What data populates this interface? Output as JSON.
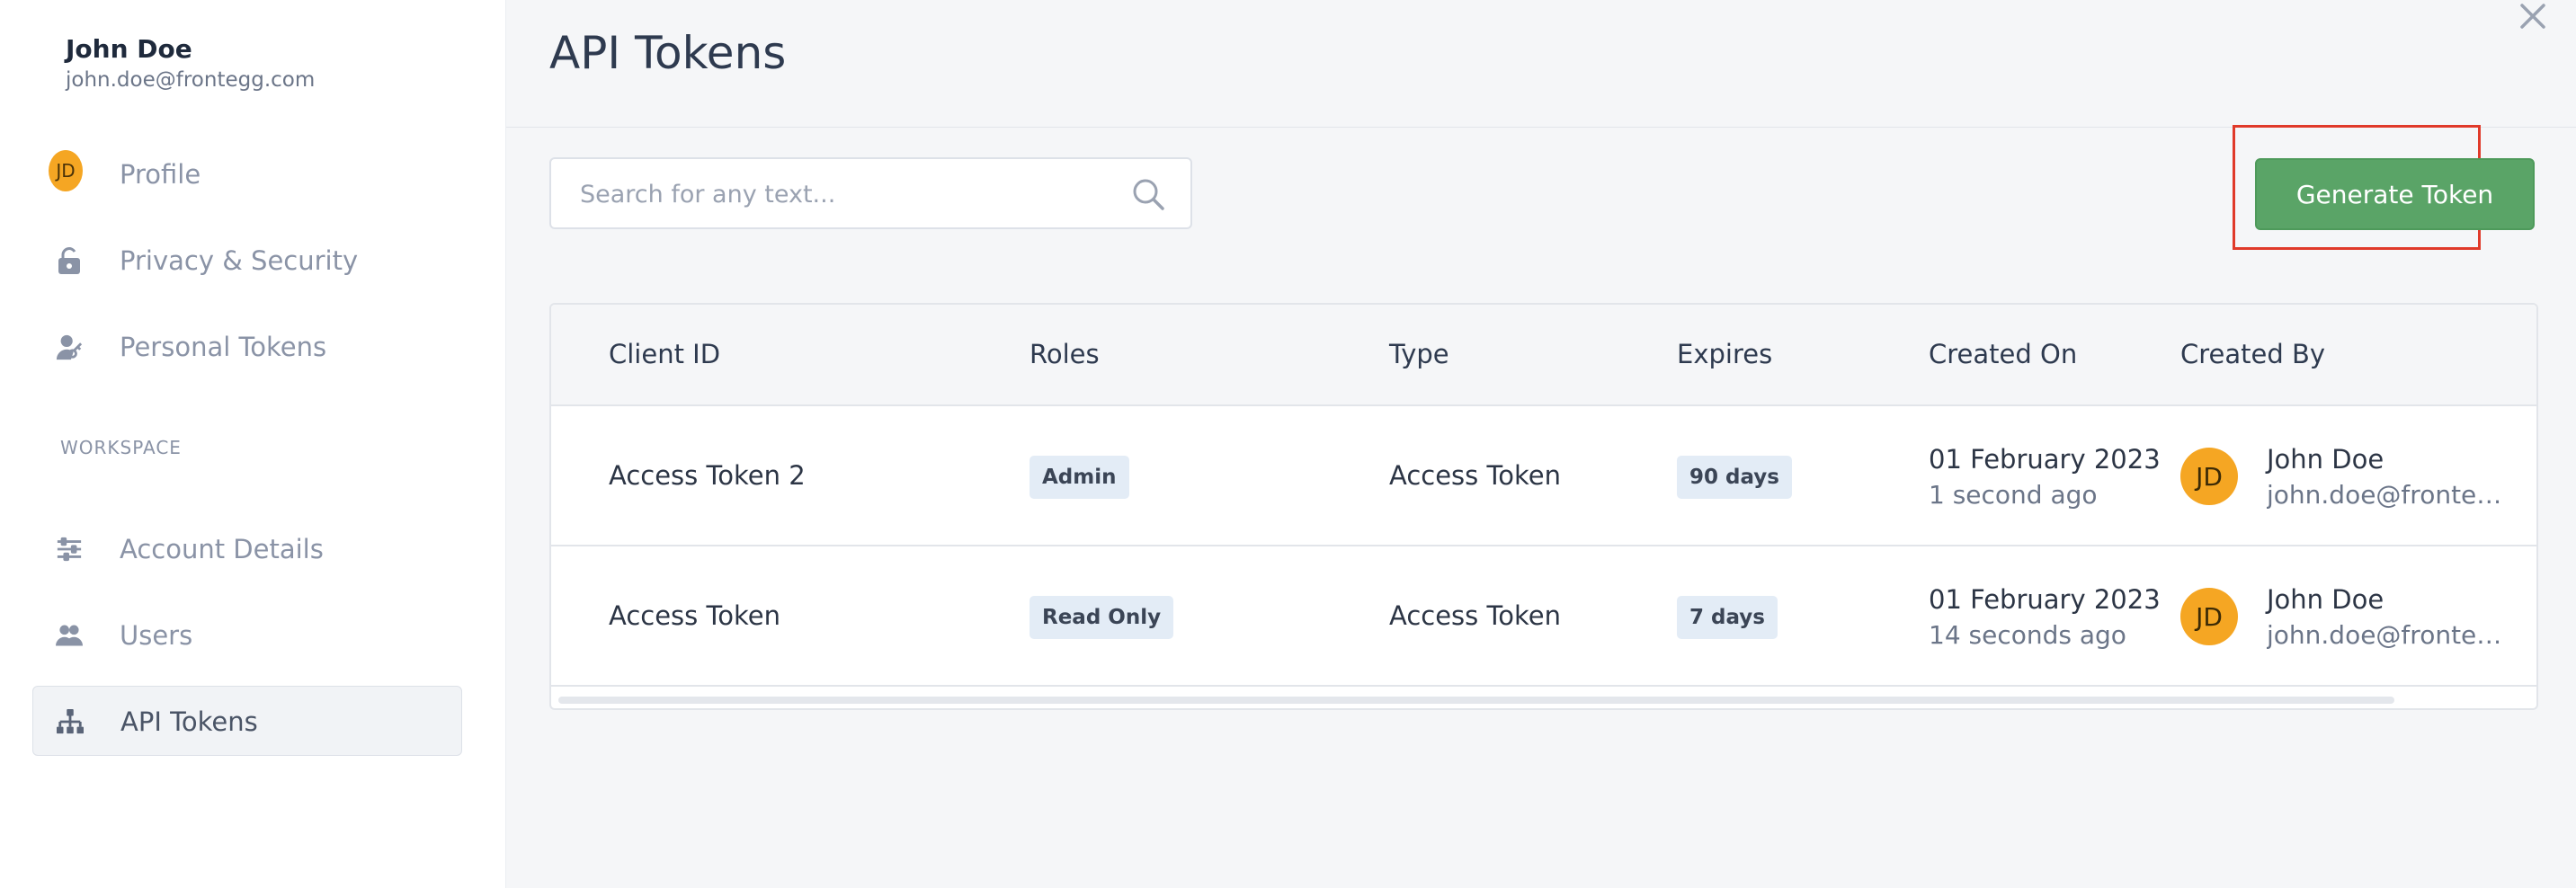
{
  "user": {
    "name": "John Doe",
    "email": "john.doe@frontegg.com",
    "initials": "JD"
  },
  "sidebar": {
    "items": [
      {
        "label": "Profile",
        "icon": "avatar-icon"
      },
      {
        "label": "Privacy & Security",
        "icon": "lock-icon"
      },
      {
        "label": "Personal Tokens",
        "icon": "user-key-icon"
      }
    ],
    "workspace_label": "WORKSPACE",
    "workspace_items": [
      {
        "label": "Account Details",
        "icon": "sliders-icon"
      },
      {
        "label": "Users",
        "icon": "users-icon"
      },
      {
        "label": "API Tokens",
        "icon": "hierarchy-icon",
        "active": true
      }
    ]
  },
  "main": {
    "title": "API Tokens",
    "search": {
      "placeholder": "Search for any text...",
      "value": ""
    },
    "generate_button": "Generate Token",
    "table": {
      "columns": [
        "Client ID",
        "Roles",
        "Type",
        "Expires",
        "Created On",
        "Created By"
      ],
      "rows": [
        {
          "client_id": "Access Token 2",
          "role": "Admin",
          "type": "Access Token",
          "expires": "90 days",
          "created_on": "01 February 2023",
          "created_ago": "1 second ago",
          "creator_initials": "JD",
          "creator_name": "John Doe",
          "creator_email": "john.doe@frontegg.com"
        },
        {
          "client_id": "Access Token",
          "role": "Read Only",
          "type": "Access Token",
          "expires": "7 days",
          "created_on": "01 February 2023",
          "created_ago": "14 seconds ago",
          "creator_initials": "JD",
          "creator_name": "John Doe",
          "creator_email": "john.doe@frontegg.com"
        }
      ]
    }
  },
  "colors": {
    "accent_green": "#5aa467",
    "highlight_red": "#e03a2a",
    "avatar_orange": "#f5a623"
  }
}
